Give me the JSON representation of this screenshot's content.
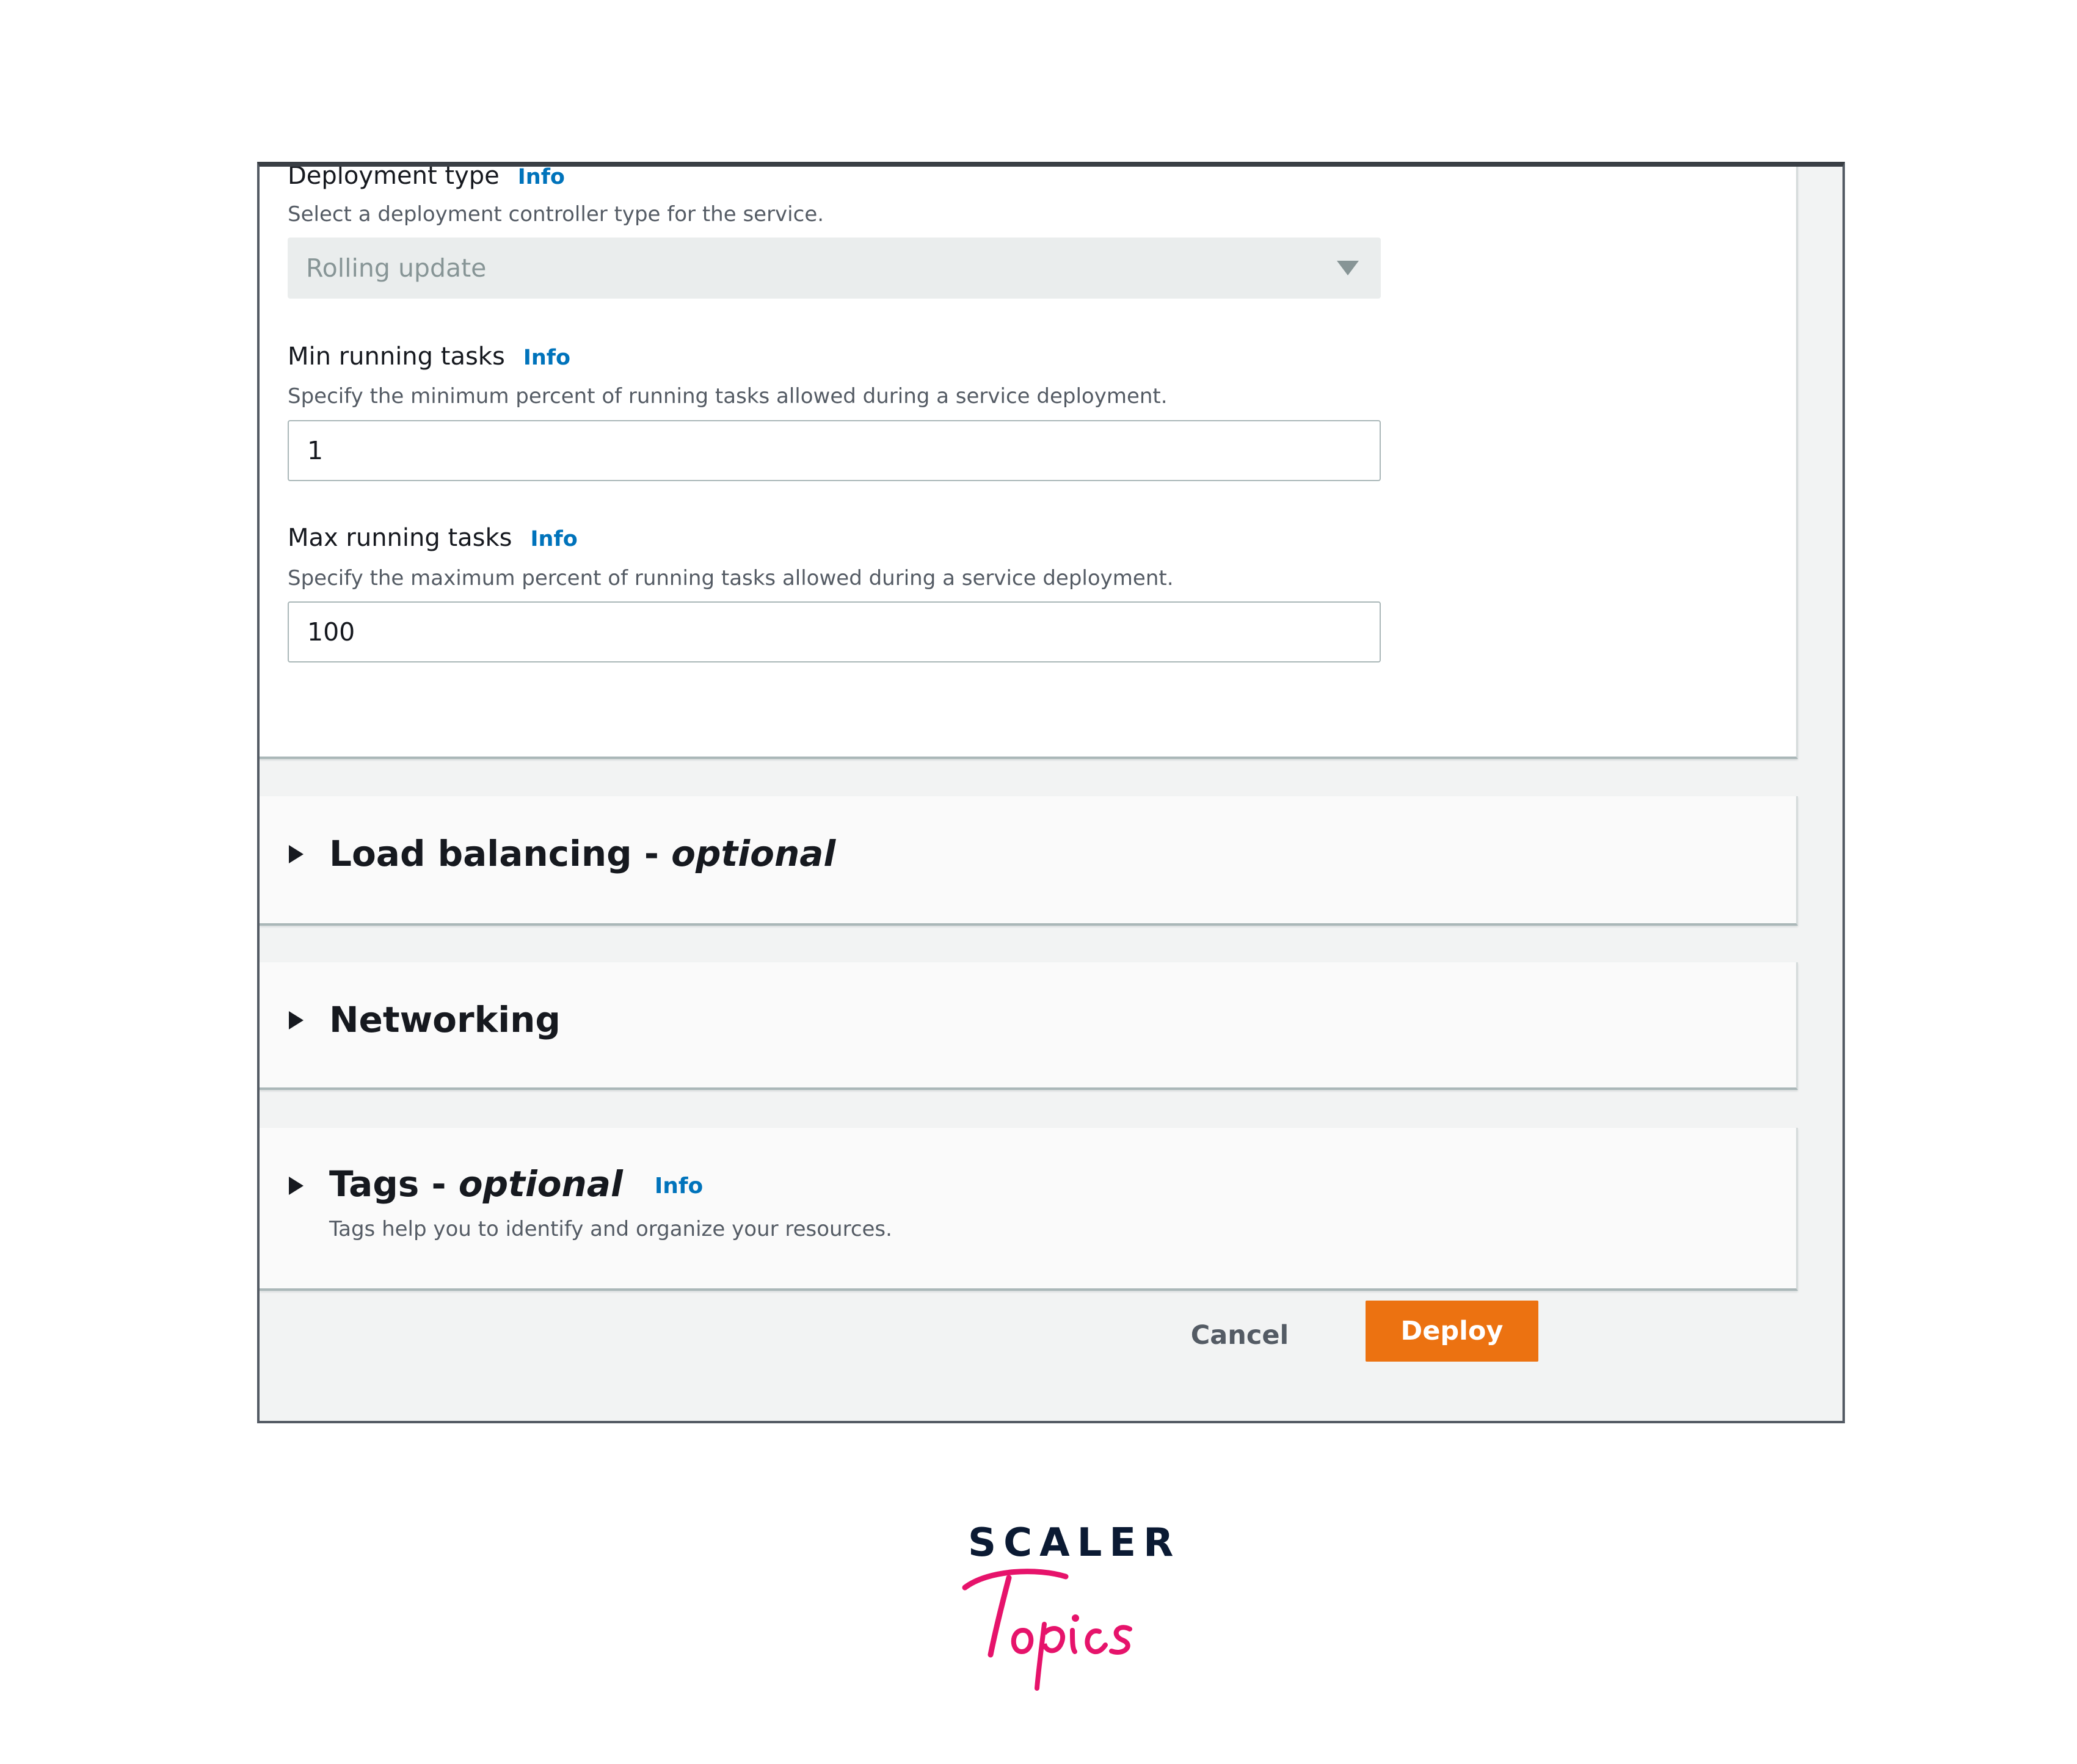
{
  "deployment_type": {
    "label": "Deployment type",
    "info": "Info",
    "description": "Select a deployment controller type for the service.",
    "selected": "Rolling update"
  },
  "min_running_tasks": {
    "label": "Min running tasks",
    "info": "Info",
    "description": "Specify the minimum percent of running tasks allowed during a service deployment.",
    "value": "1"
  },
  "max_running_tasks": {
    "label": "Max running tasks",
    "info": "Info",
    "description": "Specify the maximum percent of running tasks allowed during a service deployment.",
    "value": "100"
  },
  "sections": {
    "load_balancing": {
      "title": "Load balancing - ",
      "optional": "optional"
    },
    "networking": {
      "title": "Networking"
    },
    "tags": {
      "title": "Tags - ",
      "optional": "optional",
      "info": "Info",
      "description": "Tags help you to identify and organize your resources."
    }
  },
  "footer": {
    "cancel": "Cancel",
    "deploy": "Deploy"
  },
  "logo": {
    "top": "SCALER",
    "script": "Topics"
  },
  "colors": {
    "accent": "#ec7211",
    "link": "#0073bb",
    "brand_pink": "#e6136b",
    "brand_navy": "#0b1a33"
  },
  "icons": [
    "caret-down-icon",
    "expand-triangle-icon"
  ]
}
